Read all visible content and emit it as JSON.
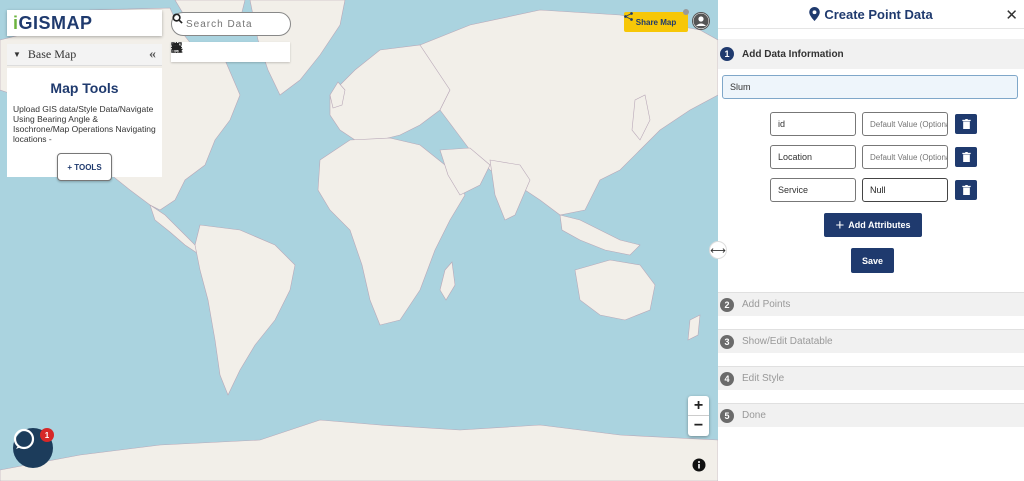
{
  "app": {
    "logo_text": "GISMAP",
    "logo_prefix": "i"
  },
  "sidebar": {
    "basemap_label": "Base Map",
    "collapse_glyph": "«",
    "tools_title": "Map Tools",
    "tools_description": "Upload GIS data/Style Data/Navigate Using Bearing Angle & Isochrone/Map Operations Navigating locations -",
    "tools_button": "+ TOOLS"
  },
  "search": {
    "placeholder": "Search Data"
  },
  "toolbar": {
    "icons": [
      "locate-icon",
      "fullscreen-icon",
      "print-icon",
      "zoom-search-icon",
      "measure-icon",
      "layers-icon"
    ]
  },
  "header": {
    "share_label": "Share Map"
  },
  "zoom": {
    "plus": "+",
    "minus": "−"
  },
  "chat": {
    "badge_count": "1"
  },
  "panel": {
    "title": "Create Point Data",
    "close_glyph": "✕",
    "steps": [
      {
        "num": "1",
        "label": "Add Data Information"
      },
      {
        "num": "2",
        "label": "Add Points"
      },
      {
        "num": "3",
        "label": "Show/Edit Datatable"
      },
      {
        "num": "4",
        "label": "Edit Style"
      },
      {
        "num": "5",
        "label": "Done"
      }
    ],
    "layer_name": "Slum",
    "attributes": [
      {
        "name": "id",
        "default_value": "",
        "default_placeholder": "Default Value (Optional)"
      },
      {
        "name": "Location",
        "default_value": "",
        "default_placeholder": "Default Value (Optional)"
      },
      {
        "name": "Service",
        "default_value": "Null",
        "default_placeholder": "Default Value (Optional)"
      }
    ],
    "add_attributes_label": "Add Attributes",
    "save_label": "Save"
  },
  "colors": {
    "primary": "#1f3a6e",
    "share_yellow": "#f7c707",
    "ocean": "#aad3df",
    "land": "#f2efe9",
    "accent_green": "#6cb33e"
  }
}
